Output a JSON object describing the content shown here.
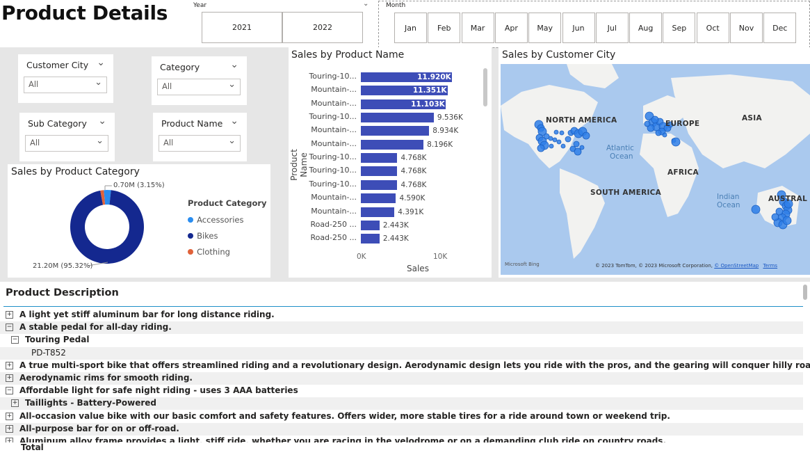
{
  "page": {
    "title": "Product Details"
  },
  "year_slicer": {
    "caption": "Year",
    "options": [
      "2021",
      "2022"
    ]
  },
  "month_slicer": {
    "caption": "Month",
    "options": [
      "Jan",
      "Feb",
      "Mar",
      "Apr",
      "May",
      "Jun",
      "Jul",
      "Aug",
      "Sep",
      "Oct",
      "Nov",
      "Dec"
    ]
  },
  "filters": {
    "customer_city": {
      "label": "Customer City",
      "value": "All"
    },
    "category": {
      "label": "Category",
      "value": "All"
    },
    "sub_category": {
      "label": "Sub Category",
      "value": "All"
    },
    "product_name": {
      "label": "Product Name",
      "value": "All"
    }
  },
  "category_chart": {
    "title": "Sales by Product Category",
    "legend_title": "Product Category",
    "label_small": "0.70M (3.15%)",
    "label_big": "21.20M (95.32%)",
    "colors": {
      "Accessories": "#2a8df0",
      "Bikes": "#14288f",
      "Clothing": "#e0623a"
    },
    "chart_data": {
      "type": "pie",
      "title": "Sales by Product Category",
      "legend_title": "Product Category",
      "categories": [
        "Accessories",
        "Bikes",
        "Clothing"
      ],
      "values_pct": [
        3.15,
        95.32,
        1.53
      ],
      "labels": [
        "0.70M (3.15%)",
        "21.20M (95.32%)",
        ""
      ],
      "legend_placement": "right"
    }
  },
  "product_chart": {
    "title": "Sales by Product Name",
    "xlabel": "Sales",
    "ylabel": "Product Name",
    "bar_color": "#3d4db7",
    "chart_data": {
      "type": "bar",
      "orientation": "horizontal",
      "title": "Sales by Product Name",
      "xlabel": "Sales",
      "ylabel": "Product Name",
      "categories": [
        "Touring-10...",
        "Mountain-...",
        "Mountain-...",
        "Touring-10...",
        "Mountain-...",
        "Mountain-...",
        "Touring-10...",
        "Touring-10...",
        "Touring-10...",
        "Mountain-...",
        "Mountain-...",
        "Road-250 ...",
        "Road-250 ..."
      ],
      "values": [
        11920,
        11351,
        11103,
        9536,
        8934,
        8196,
        4768,
        4768,
        4768,
        4590,
        4391,
        2443,
        2443
      ],
      "data_labels": [
        "11.920K",
        "11.351K",
        "11.103K",
        "9.536K",
        "8.934K",
        "8.196K",
        "4.768K",
        "4.768K",
        "4.768K",
        "4.590K",
        "4.391K",
        "2.443K",
        "2.443K"
      ],
      "xlim": [
        0,
        10000
      ],
      "x_ticks": [
        "0K",
        "10K"
      ],
      "grid": false
    }
  },
  "map_card": {
    "title": "Sales by Customer City",
    "labels": {
      "north_america": "NORTH AMERICA",
      "europe": "EUROPE",
      "asia": "ASIA",
      "africa": "AFRICA",
      "south_america": "SOUTH AMERICA",
      "australia": "AUSTRAL",
      "atlantic": "Atlantic",
      "atlantic2": "Ocean",
      "indian": "Indian",
      "indian2": "Ocean"
    },
    "attribution": "© 2023 TomTom, © 2023 Microsoft Corporation,",
    "osm_link": "© OpenStreetMap",
    "terms_link": "Terms",
    "bing": "Microsoft Bing",
    "colors": {
      "water": "#aac9ee",
      "land": "#f2f2f0",
      "bubble": "#2f7fe8"
    }
  },
  "product_description": {
    "title": "Product Description",
    "rows": [
      {
        "text": "A light yet stiff aluminum bar for long distance riding.",
        "toggle": "+",
        "level": 0,
        "bold": true
      },
      {
        "text": "A stable pedal for all-day riding.",
        "toggle": "−",
        "level": 0,
        "bold": true
      },
      {
        "text": "Touring Pedal",
        "toggle": "−",
        "level": 1,
        "bold": true
      },
      {
        "text": "PD-T852",
        "toggle": "",
        "level": 2,
        "bold": false
      },
      {
        "text": "A true multi-sport bike that offers streamlined riding and a revolutionary design. Aerodynamic design lets you ride with the pros, and the gearing will conquer hilly roads.",
        "toggle": "+",
        "level": 0,
        "bold": true
      },
      {
        "text": "Aerodynamic rims for smooth riding.",
        "toggle": "+",
        "level": 0,
        "bold": true
      },
      {
        "text": "Affordable light for safe night riding - uses 3 AAA batteries",
        "toggle": "−",
        "level": 0,
        "bold": true
      },
      {
        "text": "Taillights - Battery-Powered",
        "toggle": "+",
        "level": 1,
        "bold": true
      },
      {
        "text": "All-occasion value bike with our basic comfort and safety features. Offers wider, more stable tires for a ride around town or weekend trip.",
        "toggle": "+",
        "level": 0,
        "bold": true
      },
      {
        "text": "All-purpose bar for on or off-road.",
        "toggle": "+",
        "level": 0,
        "bold": true
      },
      {
        "text": "Aluminum alloy frame provides a light, stiff ride, whether you are racing in the velodrome or on a demanding club ride on country roads.",
        "toggle": "+",
        "level": 0,
        "bold": true
      }
    ],
    "total_label": "Total"
  }
}
